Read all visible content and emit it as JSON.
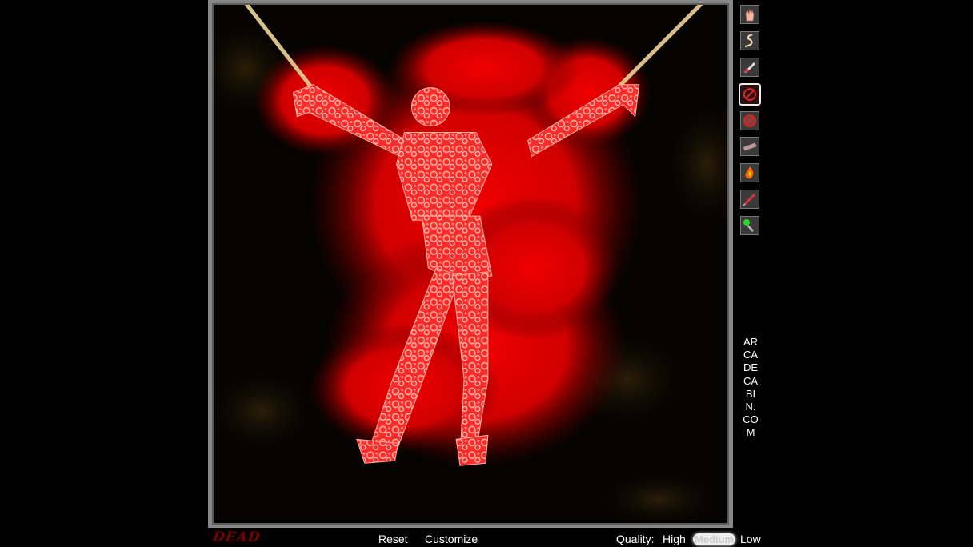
{
  "toolbar": {
    "tools": [
      {
        "name": "grab-hand-tool-icon"
      },
      {
        "name": "rope-tool-icon"
      },
      {
        "name": "knife-tool-icon"
      },
      {
        "name": "no-entry-tool-icon",
        "selected": true
      },
      {
        "name": "cancel-tool-icon"
      },
      {
        "name": "saw-tool-icon"
      },
      {
        "name": "fire-tool-icon"
      },
      {
        "name": "syringe-tool-icon"
      },
      {
        "name": "acid-tool-icon"
      }
    ]
  },
  "site_label": "ARCADECABIN.COM",
  "bottom": {
    "logo_text": "DEAD",
    "reset_label": "Reset",
    "customize_label": "Customize",
    "quality_label": "Quality:",
    "quality_options": [
      "High",
      "Medium",
      "Low"
    ],
    "quality_selected": "Medium"
  },
  "colors": {
    "blood": "#e00000",
    "figure": "#ff3a3a",
    "rope": "#d8c08a",
    "frame": "#888888"
  }
}
